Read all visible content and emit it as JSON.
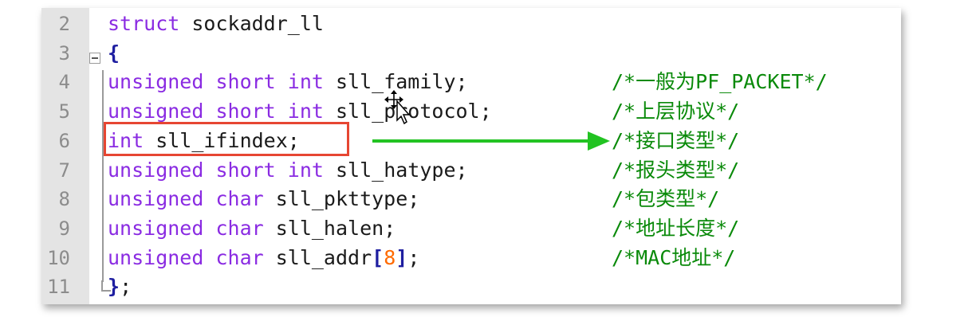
{
  "editor": {
    "lines": [
      {
        "num": "2",
        "tokens": [
          {
            "t": "struct",
            "c": "kw"
          },
          {
            "t": " sockaddr_ll",
            "c": "plain"
          }
        ],
        "comment": ""
      },
      {
        "num": "3",
        "tokens": [
          {
            "t": "{",
            "c": "brace"
          }
        ],
        "comment": ""
      },
      {
        "num": "4",
        "tokens": [
          {
            "t": "unsigned short int",
            "c": "kw"
          },
          {
            "t": " sll_family",
            "c": "plain"
          },
          {
            "t": ";",
            "c": "punct"
          }
        ],
        "comment": "/*一般为PF_PACKET*/"
      },
      {
        "num": "5",
        "tokens": [
          {
            "t": "unsigned short int",
            "c": "kw"
          },
          {
            "t": " sll_protocol",
            "c": "plain"
          },
          {
            "t": ";",
            "c": "punct"
          }
        ],
        "comment": "/*上层协议*/"
      },
      {
        "num": "6",
        "tokens": [
          {
            "t": "int",
            "c": "kw"
          },
          {
            "t": " sll_ifindex",
            "c": "plain"
          },
          {
            "t": ";",
            "c": "punct"
          }
        ],
        "comment": "/*接口类型*/"
      },
      {
        "num": "7",
        "tokens": [
          {
            "t": "unsigned short int",
            "c": "kw"
          },
          {
            "t": " sll_hatype",
            "c": "plain"
          },
          {
            "t": ";",
            "c": "punct"
          }
        ],
        "comment": "/*报头类型*/"
      },
      {
        "num": "8",
        "tokens": [
          {
            "t": "unsigned char",
            "c": "kw"
          },
          {
            "t": " sll_pkttype",
            "c": "plain"
          },
          {
            "t": ";",
            "c": "punct"
          }
        ],
        "comment": "/*包类型*/"
      },
      {
        "num": "9",
        "tokens": [
          {
            "t": "unsigned char",
            "c": "kw"
          },
          {
            "t": " sll_halen",
            "c": "plain"
          },
          {
            "t": ";",
            "c": "punct"
          }
        ],
        "comment": "/*地址长度*/"
      },
      {
        "num": "10",
        "tokens": [
          {
            "t": "unsigned char",
            "c": "kw"
          },
          {
            "t": " sll_addr",
            "c": "plain"
          },
          {
            "t": "[",
            "c": "brace"
          },
          {
            "t": "8",
            "c": "num"
          },
          {
            "t": "]",
            "c": "brace"
          },
          {
            "t": ";",
            "c": "punct"
          }
        ],
        "comment": "/*MAC地址*/"
      },
      {
        "num": "11",
        "tokens": [
          {
            "t": "}",
            "c": "brace"
          },
          {
            "t": ";",
            "c": "punct"
          }
        ],
        "comment": ""
      }
    ]
  },
  "colors": {
    "keyword": "#8a2be2",
    "comment": "#0a8a0a",
    "number": "#ff6a00",
    "highlight_box": "#e64632",
    "arrow": "#22c322"
  },
  "icons": {
    "fold": "fold-minus-icon",
    "cursor": "move-cursor-icon",
    "arrow": "arrow-right-icon"
  }
}
